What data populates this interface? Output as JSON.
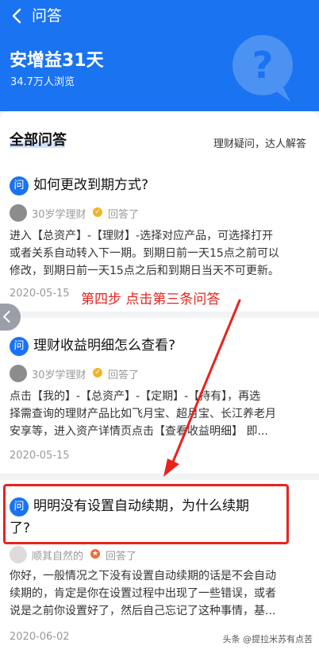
{
  "nav": {
    "title": "问答"
  },
  "product": {
    "title": "安增益31天",
    "views": "34.7万人浏览"
  },
  "section": {
    "title": "全部问答",
    "subtitle": "理财疑问，达人解答"
  },
  "qa_items": [
    {
      "icon": "问",
      "question": "如何更改到期方式?",
      "user": "30岁学理财",
      "answered_label": "回答了",
      "answer_lines": [
        "进入【总资产】-【理财】-选择对应产品，可选择打开",
        "或者关系自动转入下一期。到期日前一天15点之前可以",
        "修改，到期日前一天15点之后和到期日当天不可更新。"
      ],
      "date": "2020-05-15"
    },
    {
      "icon": "问",
      "question": "理财收益明细怎么查看?",
      "user": "30岁学理财",
      "answered_label": "回答了",
      "answer_lines": [
        "点击【我的】-【总资产】-【定期】-【持有】，再选",
        "择需查询的理财产品比如飞月宝、超月宝、长江养老月",
        "安享等，进入资产详情页点击【查看收益明细】 即..."
      ],
      "date": "2020-05-15"
    },
    {
      "icon": "问",
      "question_line1": "明明没有设置自动续期，为什么续期",
      "question_line2": "了?",
      "user": "顺其自然的",
      "answered_label": "回答了",
      "answer_lines": [
        "你好，一般情况之下没有设置自动续期的话是不会自动",
        "续期的，肯定是你在设置过程中出现了一些错误，或者",
        "说是之前你设置好了，然后自己忘记了这种事情，基..."
      ],
      "date": "2020-06-02"
    }
  ],
  "annotation": {
    "text": "第四步  点击第三条问答",
    "color": "#e8231e"
  },
  "watermark": "头条 @提拉米苏有点苦",
  "colors": {
    "primary": "#1a73f0",
    "annotation": "#e8231e",
    "badge": "#f0b429"
  }
}
